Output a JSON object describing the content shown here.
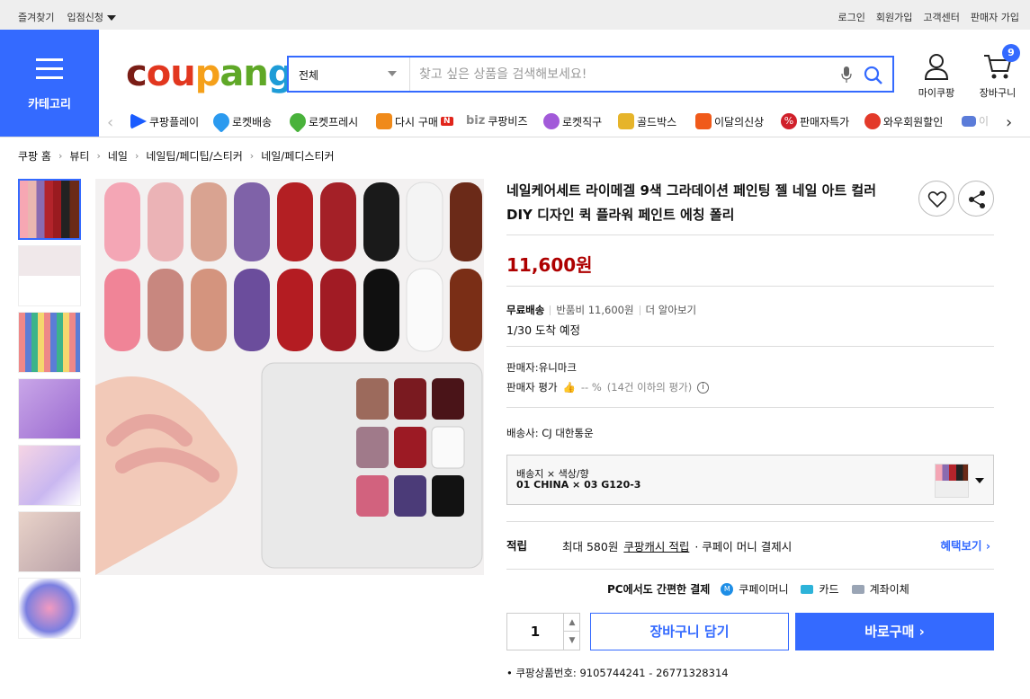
{
  "topbar": {
    "bookmark": "즐겨찾기",
    "partner": "입점신청",
    "login": "로그인",
    "signup": "회원가입",
    "support": "고객센터",
    "seller_signup": "판매자 가입"
  },
  "header": {
    "category_label": "카테고리",
    "logo": {
      "c": "c",
      "o": "ou",
      "p": "p",
      "a": "an",
      "g": "g"
    },
    "search_category": "전체",
    "search_placeholder": "찾고 싶은 상품을 검색해보세요!",
    "mycoupang": "마이쿠팡",
    "cart": "장바구니",
    "cart_count": "9"
  },
  "nav": [
    {
      "label": "쿠팡플레이",
      "color": "#1a5cff"
    },
    {
      "label": "로켓배송",
      "color": "#2b9aef"
    },
    {
      "label": "로켓프레시",
      "color": "#49b23b"
    },
    {
      "label": "다시 구매",
      "color": "#f08a1a"
    },
    {
      "label": "쿠팡비즈",
      "color": "#888888"
    },
    {
      "label": "로켓직구",
      "color": "#a25ad9"
    },
    {
      "label": "골드박스",
      "color": "#e6b42a"
    },
    {
      "label": "이달의신상",
      "color": "#f05a1a"
    },
    {
      "label": "판매자특가",
      "color": "#d0202a"
    },
    {
      "label": "와우회원할인",
      "color": "#e33a2a"
    },
    {
      "label": "이",
      "color": "#5b7cd9"
    }
  ],
  "nav_extra": {
    "new_badge": "N",
    "biz": "biz"
  },
  "breadcrumb": [
    "쿠팡 홈",
    "뷰티",
    "네일",
    "네일팁/페디팁/스티커",
    "네일/페디스티커"
  ],
  "product": {
    "title": "네일케어세트 라이메겔 9색 그라데이션 페인팅 젤 네일 아트 컬러 DIY 디자인 퀵 플라워 페인트 에칭 폴리",
    "price": "11,600원",
    "shipping_free": "무료배송",
    "return_fee": "반품비 11,600원",
    "learn_more": "더 알아보기",
    "arrival": "1/30 도착 예정",
    "seller": "판매자:유니마크",
    "rating_label": "판매자 평가",
    "rating_value": "-- %",
    "rating_note": "(14건 이하의 평가)",
    "carrier": "배송사:  CJ 대한통운",
    "option_label": "배송지 × 색상/향",
    "option_value": "01 CHINA × 03 G120-3",
    "reward_key": "적립",
    "reward_max": "최대 580원",
    "reward_link": "쿠팡캐시 적립",
    "reward_tail": "· 쿠페이 머니 결제시",
    "reward_more": "혜택보기",
    "pay_title": "PC에서도 간편한 결제",
    "pay_methods": [
      "쿠페이머니",
      "카드",
      "계좌이체"
    ],
    "quantity": "1",
    "add_cart": "장바구니 담기",
    "buy_now": "바로구매",
    "product_id": "쿠팡상품번호: 9105744241 - 26771328314"
  }
}
